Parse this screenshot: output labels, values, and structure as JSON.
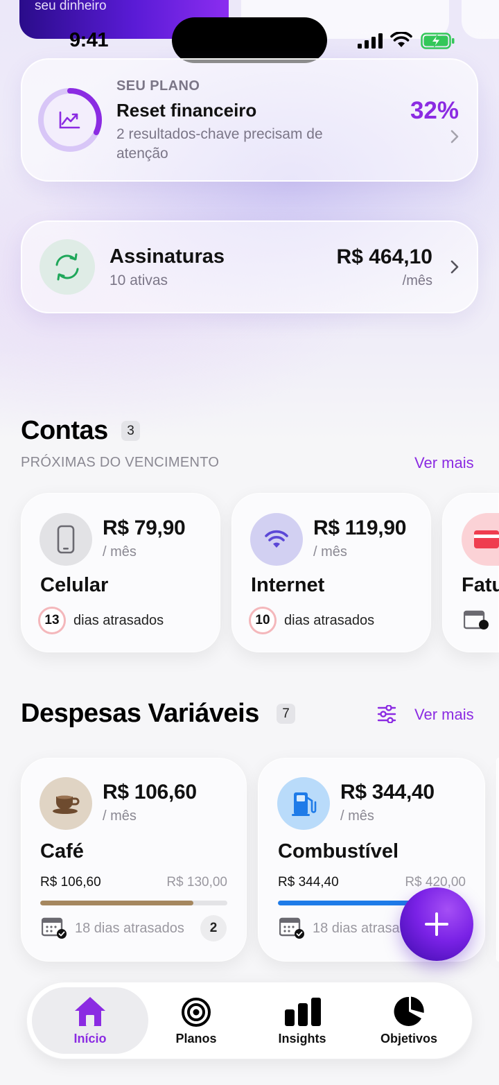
{
  "top_strip": {
    "purple_card_label": "seu dinheiro"
  },
  "status_bar": {
    "time": "9:41"
  },
  "plan": {
    "kicker": "SEU PLANO",
    "title": "Reset financeiro",
    "subtitle": "2 resultados-chave precisam de atenção",
    "percent": "32%",
    "progress": 0.32,
    "icon": "trending-up-icon"
  },
  "subscriptions": {
    "title": "Assinaturas",
    "subtitle": "10 ativas",
    "amount": "R$ 464,10",
    "period": "/mês",
    "icon": "refresh-icon"
  },
  "contas": {
    "title": "Contas",
    "count": "3",
    "kicker": "PRÓXIMAS DO VENCIMENTO",
    "see_more": "Ver mais",
    "cards": [
      {
        "icon": "phone-icon",
        "amount": "R$ 79,90",
        "period": "/ mês",
        "name": "Celular",
        "days": "13",
        "days_label": "dias atrasados"
      },
      {
        "icon": "wifi-icon",
        "amount": "R$ 119,90",
        "period": "/ mês",
        "name": "Internet",
        "days": "10",
        "days_label": "dias atrasados"
      },
      {
        "icon": "credit-card-icon",
        "name": "Fatu"
      }
    ]
  },
  "despesas": {
    "title": "Despesas Variáveis",
    "count": "7",
    "see_more": "Ver mais",
    "cards": [
      {
        "icon": "coffee-icon",
        "amount": "R$ 106,60",
        "period": "/ mês",
        "name": "Café",
        "spent": "R$ 106,60",
        "limit": "R$ 130,00",
        "progress": 0.82,
        "bar_color": "#a5875f",
        "footer": "18 dias atrasados",
        "badge": "2"
      },
      {
        "icon": "fuel-icon",
        "amount": "R$ 344,40",
        "period": "/ mês",
        "name": "Combustível",
        "spent": "R$ 344,40",
        "limit": "R$ 420,00",
        "progress": 0.82,
        "bar_color": "#1e7be8",
        "footer": "18 dias atrasados"
      }
    ]
  },
  "tabbar": {
    "tabs": [
      {
        "label": "Início",
        "icon": "home-icon",
        "active": true
      },
      {
        "label": "Planos",
        "icon": "target-icon"
      },
      {
        "label": "Insights",
        "icon": "bar-chart-icon"
      },
      {
        "label": "Objetivos",
        "icon": "pie-chart-icon"
      }
    ]
  },
  "colors": {
    "accent": "#8b2be2",
    "overdue_ring": "#f4b7bb"
  }
}
